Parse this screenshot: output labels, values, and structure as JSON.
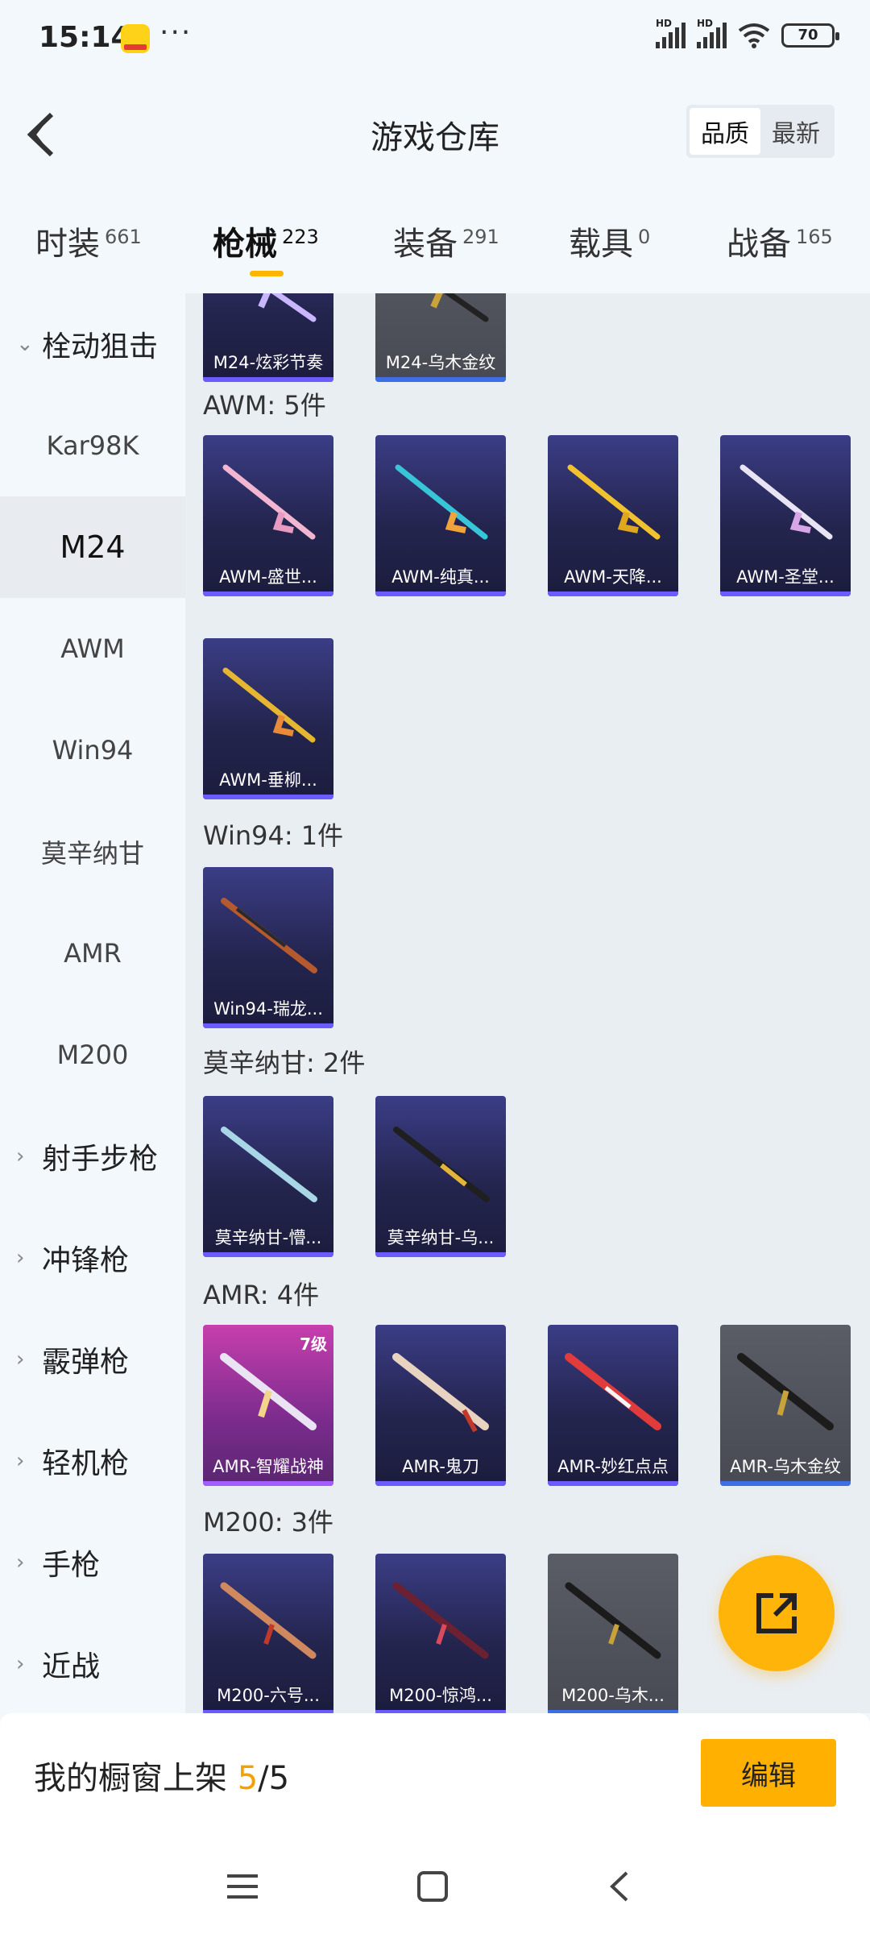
{
  "status_bar": {
    "time": "15:14",
    "battery": "70",
    "more": "···",
    "hd": "HD"
  },
  "header": {
    "title": "游戏仓库",
    "sort_options": [
      "品质",
      "最新"
    ],
    "sort_selected": "品质"
  },
  "tabs": [
    {
      "label": "时装",
      "count": "661"
    },
    {
      "label": "枪械",
      "count": "223",
      "active": true
    },
    {
      "label": "装备",
      "count": "291"
    },
    {
      "label": "载具",
      "count": "0"
    },
    {
      "label": "战备",
      "count": "165"
    }
  ],
  "sidebar": {
    "items": [
      {
        "label": "栓动狙击",
        "type": "group",
        "expanded": true
      },
      {
        "label": "Kar98K",
        "type": "sub"
      },
      {
        "label": "M24",
        "type": "sub",
        "selected": true
      },
      {
        "label": "AWM",
        "type": "sub"
      },
      {
        "label": "Win94",
        "type": "sub"
      },
      {
        "label": "莫辛纳甘",
        "type": "sub"
      },
      {
        "label": "AMR",
        "type": "sub"
      },
      {
        "label": "M200",
        "type": "sub"
      },
      {
        "label": "射手步枪",
        "type": "group"
      },
      {
        "label": "冲锋枪",
        "type": "group"
      },
      {
        "label": "霰弹枪",
        "type": "group"
      },
      {
        "label": "轻机枪",
        "type": "group"
      },
      {
        "label": "手枪",
        "type": "group"
      },
      {
        "label": "近战",
        "type": "group"
      }
    ]
  },
  "sections": {
    "top_partial": [
      {
        "name": "M24-炫彩节奏",
        "style": "purple"
      },
      {
        "name": "M24-乌木金纹",
        "style": "grey"
      }
    ],
    "awm": {
      "title": "AWM: 5件",
      "items": [
        {
          "name": "AWM-盛世...",
          "style": "purple"
        },
        {
          "name": "AWM-纯真...",
          "style": "purple"
        },
        {
          "name": "AWM-天降...",
          "style": "purple"
        },
        {
          "name": "AWM-圣堂...",
          "style": "purple"
        },
        {
          "name": "AWM-垂柳...",
          "style": "purple"
        }
      ]
    },
    "win94": {
      "title": "Win94: 1件",
      "items": [
        {
          "name": "Win94-瑞龙...",
          "style": "purple"
        }
      ]
    },
    "mosin": {
      "title": "莫辛纳甘: 2件",
      "items": [
        {
          "name": "莫辛纳甘-懵...",
          "style": "purple"
        },
        {
          "name": "莫辛纳甘-乌...",
          "style": "purple"
        }
      ]
    },
    "amr": {
      "title": "AMR: 4件",
      "items": [
        {
          "name": "AMR-智耀战神",
          "style": "pink",
          "level": "7级"
        },
        {
          "name": "AMR-鬼刀",
          "style": "purple"
        },
        {
          "name": "AMR-妙红点点",
          "style": "purple"
        },
        {
          "name": "AMR-乌木金纹",
          "style": "grey"
        }
      ]
    },
    "m200": {
      "title": "M200: 3件",
      "items": [
        {
          "name": "M200-六号...",
          "style": "purple"
        },
        {
          "name": "M200-惊鸿...",
          "style": "purple"
        },
        {
          "name": "M200-乌木...",
          "style": "grey"
        }
      ]
    }
  },
  "bottom": {
    "showcase_label": "我的橱窗上架 ",
    "showcase_current": "5",
    "showcase_total": "/5",
    "edit_label": "编辑"
  },
  "colors": {
    "accent": "#ffb400",
    "card_purple": "#2d2e63",
    "card_grey": "#4f525a",
    "card_pink": "#a43597"
  }
}
